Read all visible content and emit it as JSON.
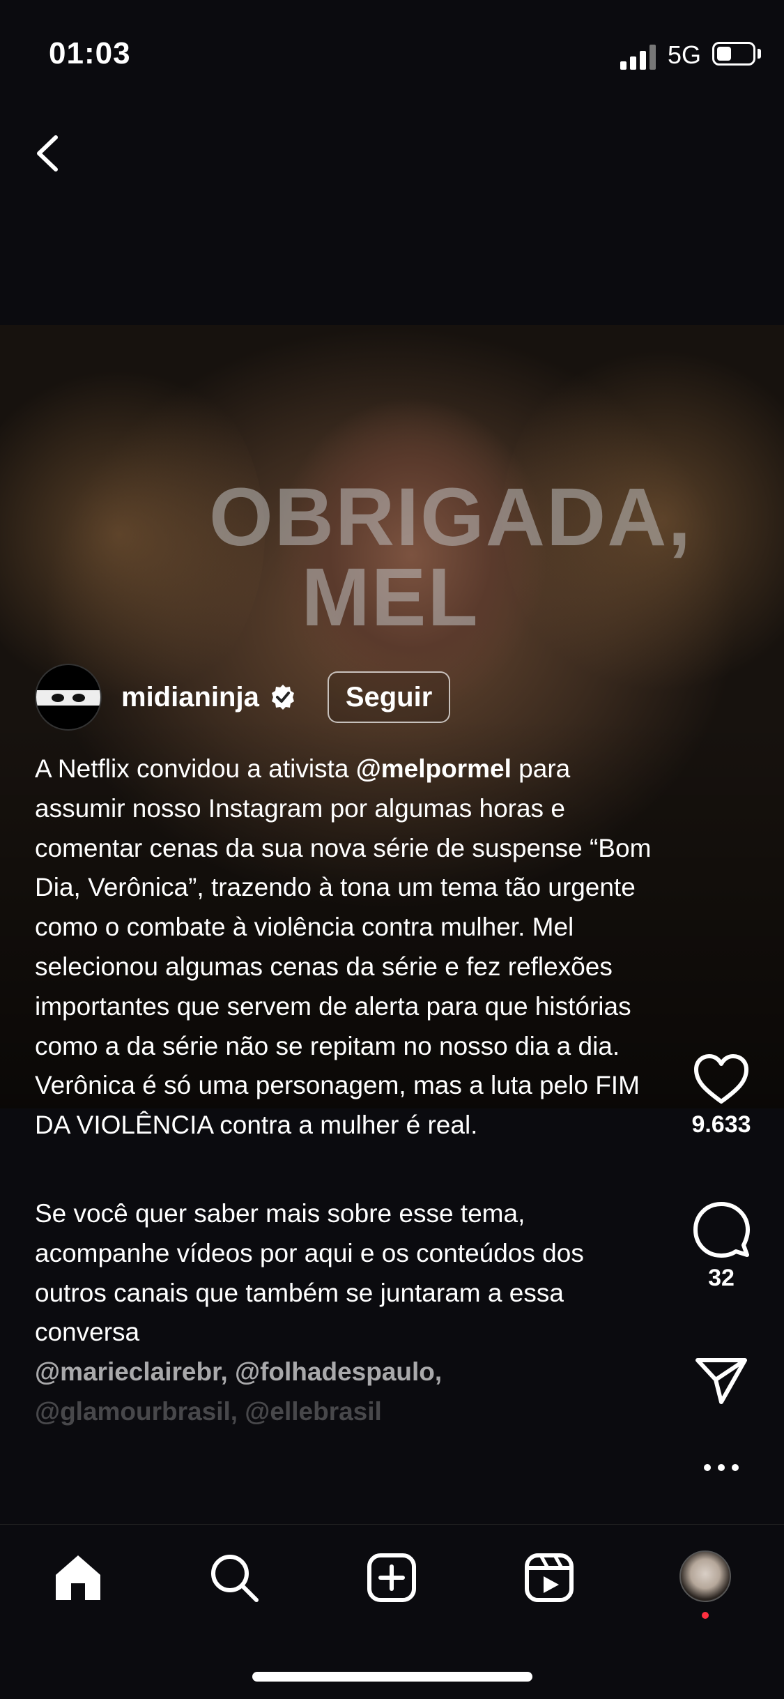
{
  "status_bar": {
    "time": "01:03",
    "network": "5G"
  },
  "post": {
    "overlay_text": [
      "OBRIGADA,",
      "MEL"
    ],
    "username": "midianinja",
    "follow_label": "Seguir",
    "caption": {
      "p1_pre": "A Netflix convidou a ativista ",
      "p1_mention": "@melpormel",
      "p1_post": " para assumir nosso Instagram por algumas horas e comentar cenas da sua nova série de suspense “Bom Dia, Verônica”, trazendo à tona um tema tão urgente como o combate à violência contra mulher. Mel selecionou algumas cenas da série e fez reflexões importantes que servem de alerta para que histórias como a da série não se repitam no nosso dia a dia. Verônica é só uma personagem, mas a luta pelo FIM DA VIOLÊNCIA contra a mulher é real.",
      "p2": "Se você quer saber mais sobre esse tema, acompanhe vídeos por aqui e os conteúdos dos outros canais que também se juntaram a essa conversa",
      "mentions_line1": "@marieclairebr, @folhadespaulo,",
      "mentions_line2": "@glamourbrasil, @ellebrasil"
    }
  },
  "actions": {
    "likes": "9.633",
    "comments": "32"
  },
  "tabbar": {
    "icons": [
      "home-icon",
      "search-icon",
      "create-icon",
      "reels-icon",
      "profile-avatar"
    ]
  },
  "colors": {
    "background": "#0b0b0f",
    "notification_dot": "#ff3040"
  }
}
